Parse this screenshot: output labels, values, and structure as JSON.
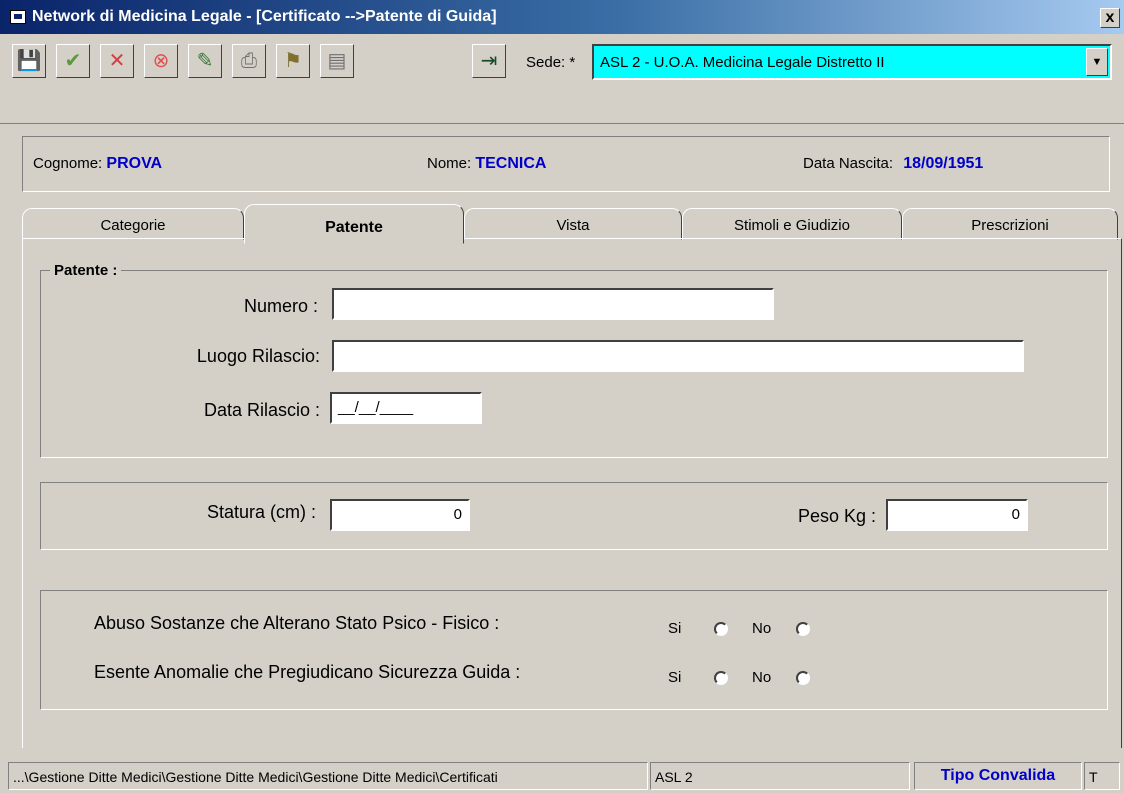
{
  "window": {
    "title": "Network di Medicina Legale - [Certificato -->Patente di Guida]",
    "close_label": "x"
  },
  "toolbar": {
    "buttons": [
      {
        "icon": "save-icon",
        "glyph": "💾"
      },
      {
        "icon": "confirm-check-icon",
        "glyph": "✔"
      },
      {
        "icon": "cancel-x-icon",
        "glyph": "✕"
      },
      {
        "icon": "stop-icon",
        "glyph": "⊗"
      },
      {
        "icon": "edit-icon",
        "glyph": "✎"
      },
      {
        "icon": "print-icon",
        "glyph": "⎙"
      },
      {
        "icon": "certificate-icon",
        "glyph": "⚑"
      },
      {
        "icon": "document-icon",
        "glyph": "▤"
      },
      {
        "icon": "exit-icon",
        "glyph": "⇥"
      }
    ],
    "sede_label": "Sede: *",
    "sede_value": "ASL 2 - U.O.A. Medicina Legale Distretto II"
  },
  "patient": {
    "cognome_label": "Cognome:",
    "cognome_value": "PROVA",
    "nome_label": "Nome:",
    "nome_value": "TECNICA",
    "nascita_label": "Data Nascita:",
    "nascita_value": "18/09/1951"
  },
  "tabs": [
    "Categorie",
    "Patente",
    "Vista",
    "Stimoli e Giudizio",
    "Prescrizioni"
  ],
  "active_tab": "Patente",
  "patente": {
    "legend": "Patente :",
    "numero_label": "Numero :",
    "numero_value": "",
    "luogo_label": "Luogo Rilascio:",
    "luogo_value": "",
    "data_label": "Data Rilascio :",
    "data_value": "__/__/____"
  },
  "misure": {
    "statura_label": "Statura (cm) :",
    "statura_value": "0",
    "peso_label": "Peso Kg :",
    "peso_value": "0"
  },
  "questions": [
    {
      "text": "Abuso Sostanze che Alterano Stato Psico - Fisico :",
      "yes": "Si",
      "no": "No"
    },
    {
      "text": "Esente Anomalie che Pregiudicano Sicurezza Guida :",
      "yes": "Si",
      "no": "No"
    }
  ],
  "statusbar": {
    "path": "...\\Gestione Ditte Medici\\Gestione Ditte Medici\\Gestione Ditte Medici\\Certificati",
    "asl": "ASL 2",
    "tipo": "Tipo Convalida",
    "extra": "T"
  }
}
